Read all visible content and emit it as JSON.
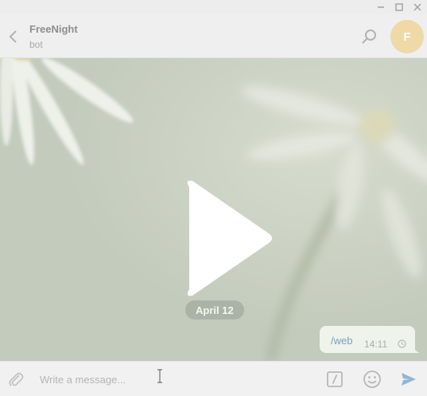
{
  "window": {
    "controls": [
      "minimize-icon",
      "maximize-icon",
      "close-icon"
    ]
  },
  "header": {
    "chat_name": "FreeNight",
    "status": "bot",
    "avatar_initial": "F",
    "avatar_color": "#efd9a7",
    "icons": [
      "back-arrow-icon",
      "search-icon"
    ]
  },
  "chat": {
    "date_label": "April 12",
    "messages": [
      {
        "text": "/web",
        "time": "14:11",
        "status_icon": "clock-icon"
      }
    ],
    "overlay_icon": "play-icon"
  },
  "composer": {
    "placeholder": "Write a message...",
    "icons": [
      "paperclip-icon",
      "bot-commands-icon",
      "emoji-icon",
      "send-icon"
    ],
    "accent_color": "#8eb6d6"
  }
}
